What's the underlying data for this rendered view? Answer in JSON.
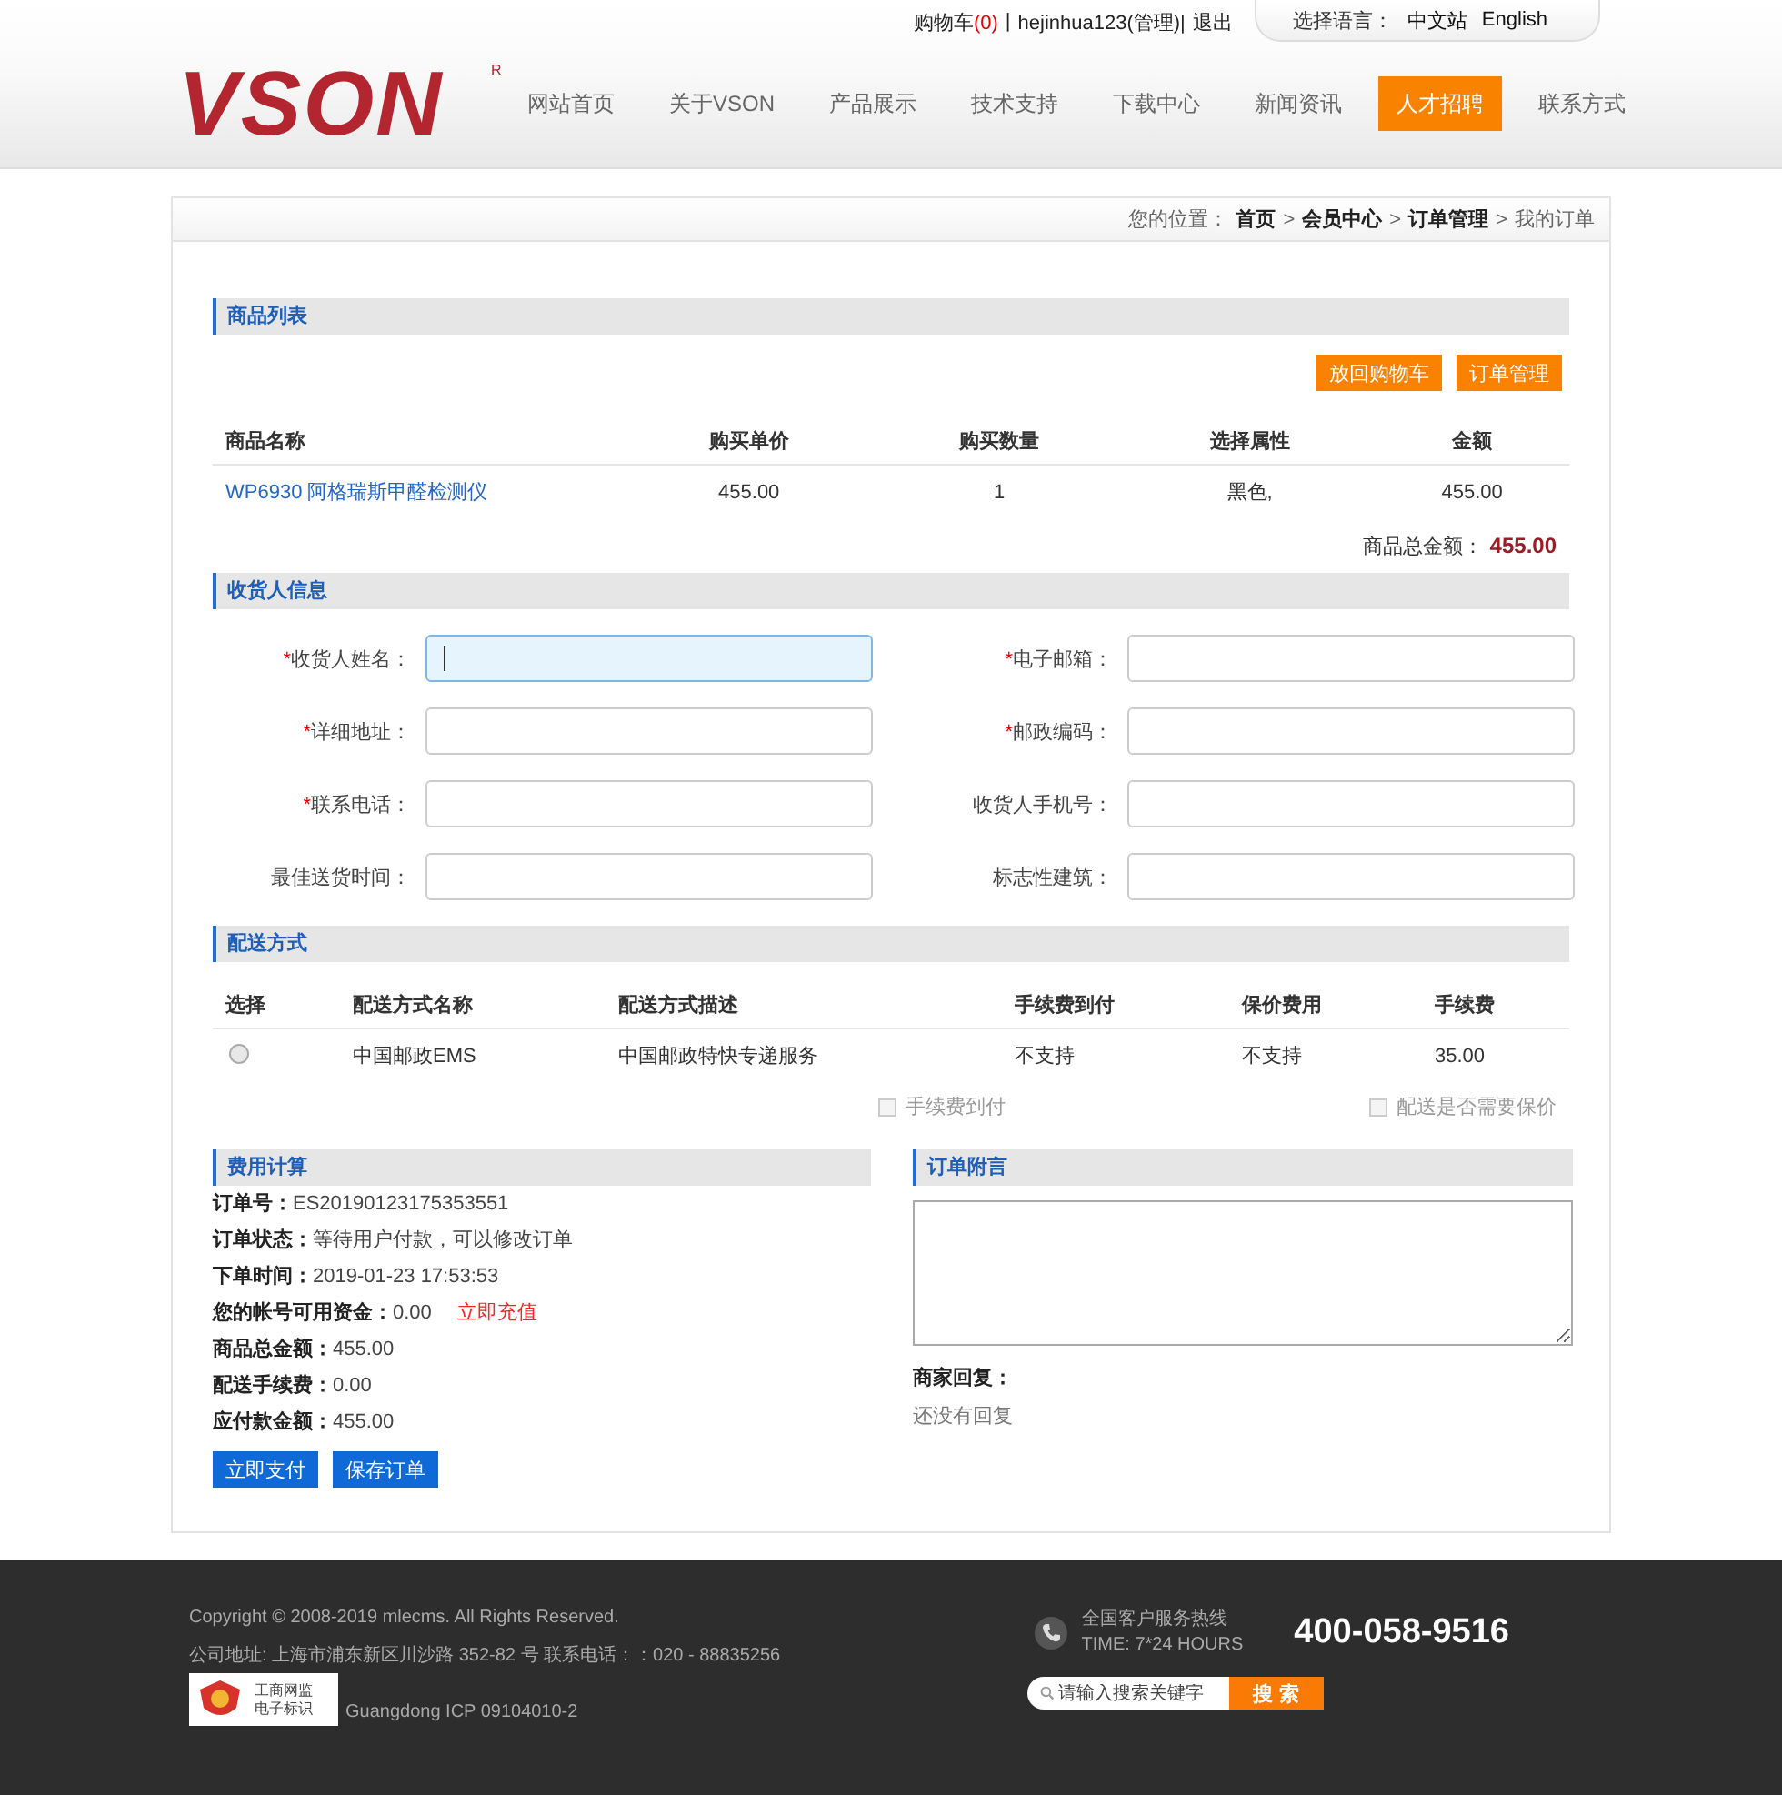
{
  "topbar": {
    "cart_label": "购物车",
    "cart_count": "(0)",
    "divider": "|",
    "user": "hejinhua123(管理)|",
    "logout": "退出",
    "language_label": "选择语言：",
    "languages": [
      "中文站",
      "English"
    ]
  },
  "logo": {
    "text": "VSON",
    "mark": "R"
  },
  "nav": [
    {
      "label": "网站首页",
      "selected": false
    },
    {
      "label": "关于VSON",
      "selected": false
    },
    {
      "label": "产品展示",
      "selected": false
    },
    {
      "label": "技术支持",
      "selected": false
    },
    {
      "label": "下载中心",
      "selected": false
    },
    {
      "label": "新闻资讯",
      "selected": false
    },
    {
      "label": "人才招聘",
      "selected": true
    },
    {
      "label": "联系方式",
      "selected": false
    }
  ],
  "breadcrumb": {
    "prefix": "您的位置：",
    "separator": ">",
    "items": [
      "首页",
      "会员中心",
      "订单管理",
      "我的订单"
    ]
  },
  "products": {
    "title": "商品列表",
    "buttons": [
      "放回购物车",
      "订单管理"
    ],
    "columns": [
      "商品名称",
      "购买单价",
      "购买数量",
      "选择属性",
      "金额"
    ],
    "rows": [
      {
        "name": "WP6930 阿格瑞斯甲醛检测仪",
        "price": "455.00",
        "quantity": "1",
        "attribute": "黑色,",
        "amount": "455.00"
      }
    ],
    "total_label": "商品总金额：",
    "total_value": "455.00"
  },
  "receiver": {
    "title": "收货人信息",
    "required_mark": "*",
    "fields": [
      {
        "label": "收货人姓名：",
        "required": true,
        "focused": true
      },
      {
        "label": "电子邮箱：",
        "required": true,
        "focused": false
      },
      {
        "label": "详细地址：",
        "required": true,
        "focused": false
      },
      {
        "label": "邮政编码：",
        "required": true,
        "focused": false
      },
      {
        "label": "联系电话：",
        "required": true,
        "focused": false
      },
      {
        "label": "收货人手机号：",
        "required": false,
        "focused": false
      },
      {
        "label": "最佳送货时间：",
        "required": false,
        "focused": false
      },
      {
        "label": "标志性建筑：",
        "required": false,
        "focused": false
      }
    ]
  },
  "delivery": {
    "title": "配送方式",
    "columns": [
      "选择",
      "配送方式名称",
      "配送方式描述",
      "手续费到付",
      "保价费用",
      "手续费"
    ],
    "rows": [
      {
        "selected": false,
        "name": "中国邮政EMS",
        "description": "中国邮政特快专递服务",
        "cod": "不支持",
        "insurance": "不支持",
        "fee": "35.00"
      }
    ],
    "options": [
      {
        "label": "手续费到付",
        "checked": false
      },
      {
        "label": "配送是否需要保价",
        "checked": false
      }
    ]
  },
  "cost": {
    "title": "费用计算",
    "items": [
      {
        "label": "订单号：",
        "value": "ES20190123175353551"
      },
      {
        "label": "订单状态：",
        "value": "等待用户付款，可以修改订单"
      },
      {
        "label": "下单时间：",
        "value": "2019-01-23 17:53:53"
      },
      {
        "label": "您的帐号可用资金：",
        "value": "0.00",
        "link": "立即充值"
      },
      {
        "label": "商品总金额：",
        "value": "455.00"
      },
      {
        "label": "配送手续费：",
        "value": "0.00"
      },
      {
        "label": "应付款金额：",
        "value": "455.00"
      }
    ],
    "buttons": [
      "立即支付",
      "保存订单"
    ]
  },
  "note": {
    "title": "订单附言",
    "reply_label": "商家回复：",
    "reply_text": "还没有回复"
  },
  "footer": {
    "copyright": "Copyright © 2008-2019 mlecms. All Rights Reserved.",
    "address": "公司地址: 上海市浦东新区川沙路 352-82 号 联系电话：：020 - 88835256",
    "badge_lines": [
      "工商网监",
      "电子标识"
    ],
    "icp": "Guangdong ICP 09104010-2",
    "hotline_label": "全国客户服务热线",
    "hotline_time": "TIME: 7*24 HOURS",
    "hotline_number": "400-058-9516",
    "search_placeholder": "请输入搜索关键字",
    "search_button": "搜 索"
  }
}
